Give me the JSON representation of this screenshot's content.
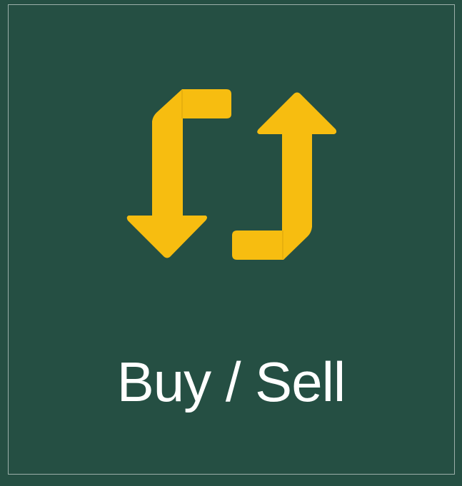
{
  "tile": {
    "label": "Buy / Sell",
    "icon": "swap-arrows-icon"
  },
  "colors": {
    "background": "#254f43",
    "accent": "#f7bd10",
    "text": "#ffffff"
  }
}
